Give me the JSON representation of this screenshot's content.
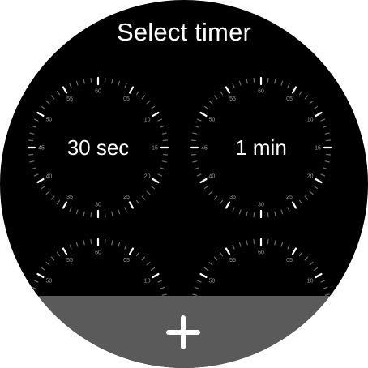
{
  "header": {
    "title": "Select timer"
  },
  "timers": [
    {
      "label": "30 sec"
    },
    {
      "label": "1 min"
    },
    {
      "label": ""
    },
    {
      "label": ""
    }
  ],
  "dial_numbers": [
    "60",
    "05",
    "10",
    "15",
    "20",
    "25",
    "30",
    "35",
    "40",
    "45",
    "50",
    "55"
  ],
  "add_button": {
    "icon": "plus-icon"
  },
  "colors": {
    "background": "#000000",
    "text": "#ffffff",
    "major_tick": "#ffffff",
    "minor_tick": "#6e6e6e",
    "dial_number": "#9a9a9a",
    "add_bar": "#5a5a5a"
  }
}
